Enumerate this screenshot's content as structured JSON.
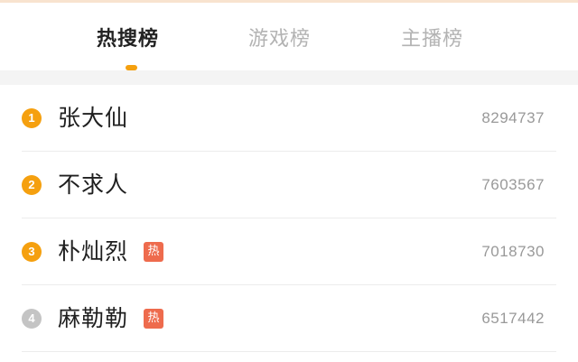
{
  "tabs": [
    {
      "label": "热搜榜",
      "active": true
    },
    {
      "label": "游戏榜",
      "active": false
    },
    {
      "label": "主播榜",
      "active": false
    }
  ],
  "colors": {
    "accent": "#f5a00f",
    "rank_top3": "#f5a00f",
    "rank_other": "#c4c4c4",
    "hot_badge": "#ee6b4d"
  },
  "list": [
    {
      "rank": "1",
      "name": "张大仙",
      "hot": false,
      "count": "8294737"
    },
    {
      "rank": "2",
      "name": "不求人",
      "hot": false,
      "count": "7603567"
    },
    {
      "rank": "3",
      "name": "朴灿烈",
      "hot": true,
      "hot_label": "热",
      "count": "7018730"
    },
    {
      "rank": "4",
      "name": "麻勒勒",
      "hot": true,
      "hot_label": "热",
      "count": "6517442"
    }
  ]
}
